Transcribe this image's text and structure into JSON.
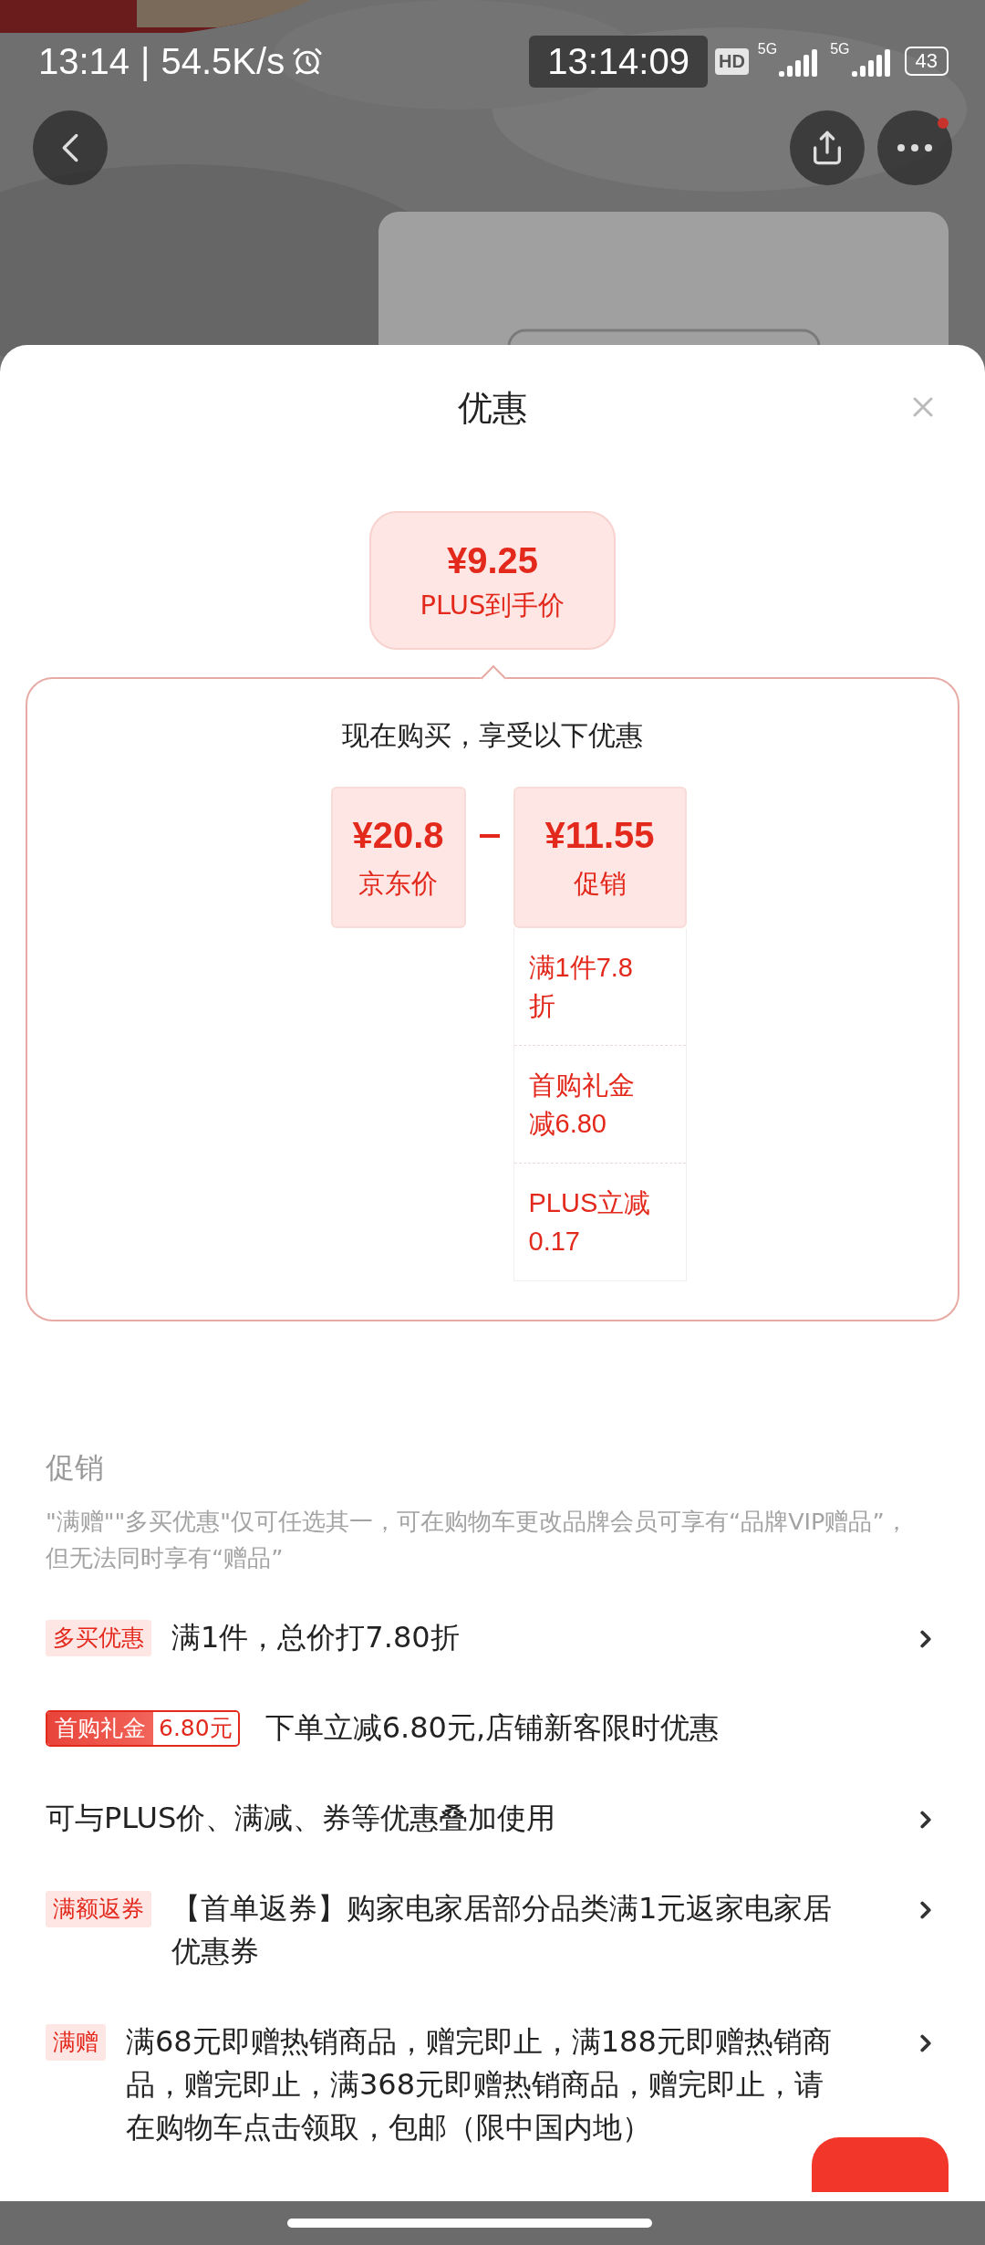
{
  "status_bar": {
    "time": "13:14",
    "separator": "|",
    "speed": "54.5K/s",
    "clock": "13:14:09",
    "hd": "HD",
    "network_1": "5G",
    "network_2": "5G",
    "battery": "43"
  },
  "top_bar": {
    "more_has_dot": true
  },
  "sheet": {
    "title": "优惠"
  },
  "final_price": {
    "price": "¥9.25",
    "label": "PLUS到手价"
  },
  "breakdown": {
    "heading": "现在购买，享受以下优惠",
    "base": {
      "price": "¥20.8",
      "label": "京东价"
    },
    "promo": {
      "price": "¥11.55",
      "label": "促销"
    },
    "items": [
      "满1件7.8折",
      "首购礼金减6.80",
      "PLUS立减0.17"
    ]
  },
  "promotions": {
    "title": "促销",
    "note": "\"满赠\"\"多买优惠\"仅可任选其一，可在购物车更改品牌会员可享有“品牌VIP赠品”，但无法同时享有“赠品”",
    "rows": [
      {
        "kind": "tag",
        "tag": "多买优惠",
        "text": "满1件，总价打7.80折",
        "has_arrow": true
      },
      {
        "kind": "coupon",
        "tag": "首购礼金",
        "amount": "6.80元",
        "text": "下单立减6.80元,店铺新客限时优惠",
        "has_arrow": false
      },
      {
        "kind": "plain",
        "text": "可与PLUS价、满减、券等优惠叠加使用",
        "has_arrow": true
      },
      {
        "kind": "tag",
        "tag": "满额返券",
        "text": "【首单返券】购家电家居部分品类满1元返家电家居优惠券",
        "has_arrow": true
      },
      {
        "kind": "tag",
        "tag": "满赠",
        "text": "满68元即赠热销商品，赠完即止，满188元即赠热销商品，赠完即止，满368元即赠热销商品，赠完即止，请在购物车点击领取，包邮（限中国内地）",
        "has_arrow": true
      }
    ]
  }
}
